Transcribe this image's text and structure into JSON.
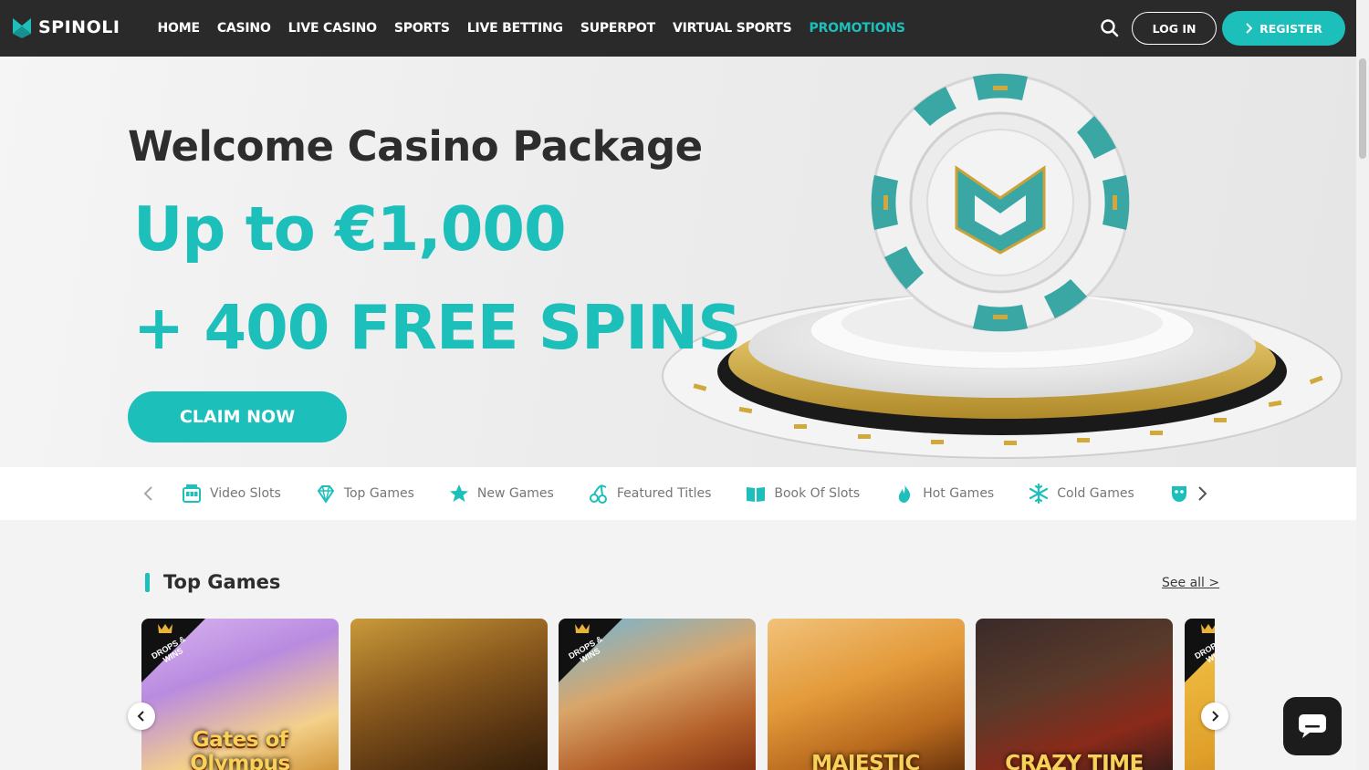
{
  "header": {
    "logo_text": "SPINOLI",
    "nav": [
      {
        "label": "HOME",
        "active": false
      },
      {
        "label": "CASINO",
        "active": false
      },
      {
        "label": "LIVE CASINO",
        "active": false
      },
      {
        "label": "SPORTS",
        "active": false
      },
      {
        "label": "LIVE BETTING",
        "active": false
      },
      {
        "label": "SUPERPOT",
        "active": false
      },
      {
        "label": "VIRTUAL SPORTS",
        "active": false
      },
      {
        "label": "PROMOTIONS",
        "active": true
      }
    ],
    "login_label": "LOG IN",
    "register_label": "REGISTER"
  },
  "hero": {
    "title": "Welcome Casino Package",
    "line1": "Up to €1,000",
    "line2": "+ 400 FREE SPINS",
    "cta": "CLAIM NOW"
  },
  "categories": [
    {
      "label": "Video Slots",
      "icon": "slot-machine-icon"
    },
    {
      "label": "Top Games",
      "icon": "diamond-icon"
    },
    {
      "label": "New Games",
      "icon": "star-icon"
    },
    {
      "label": "Featured Titles",
      "icon": "cherries-icon"
    },
    {
      "label": "Book Of Slots",
      "icon": "book-icon"
    },
    {
      "label": "Hot Games",
      "icon": "flame-icon"
    },
    {
      "label": "Cold Games",
      "icon": "snowflake-icon"
    },
    {
      "label": "",
      "icon": "mask-icon"
    }
  ],
  "top_games": {
    "title": "Top Games",
    "see_all": "See all >",
    "games": [
      {
        "name": "Gates of Olympus",
        "badge": "DROPS & WINS"
      },
      {
        "name": "",
        "badge": ""
      },
      {
        "name": "",
        "badge": "DROPS & WINS"
      },
      {
        "name": "MAJESTIC",
        "badge": ""
      },
      {
        "name": "CRAZY TIME",
        "badge": ""
      },
      {
        "name": "",
        "badge": "DROPS & WINS"
      }
    ]
  },
  "colors": {
    "accent": "#1dbfbb",
    "header_bg": "#2a2a2a"
  }
}
